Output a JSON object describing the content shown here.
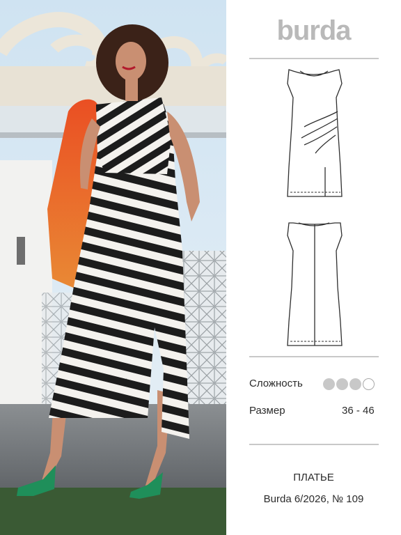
{
  "brand": "burda",
  "difficulty": {
    "label": "Сложность",
    "level": 3,
    "max": 4
  },
  "size": {
    "label": "Размер",
    "value": "36 - 46"
  },
  "garment_name": "ПЛАТЬЕ",
  "issue": "Burda 6/2026, № 109",
  "sketches": [
    "front-view",
    "back-view"
  ],
  "colors": {
    "accent_gray": "#b9b9b9",
    "jacket_orange": "#e8552b",
    "shoe_green": "#1f8f5a",
    "stripe_dark": "#1c1c1c"
  }
}
